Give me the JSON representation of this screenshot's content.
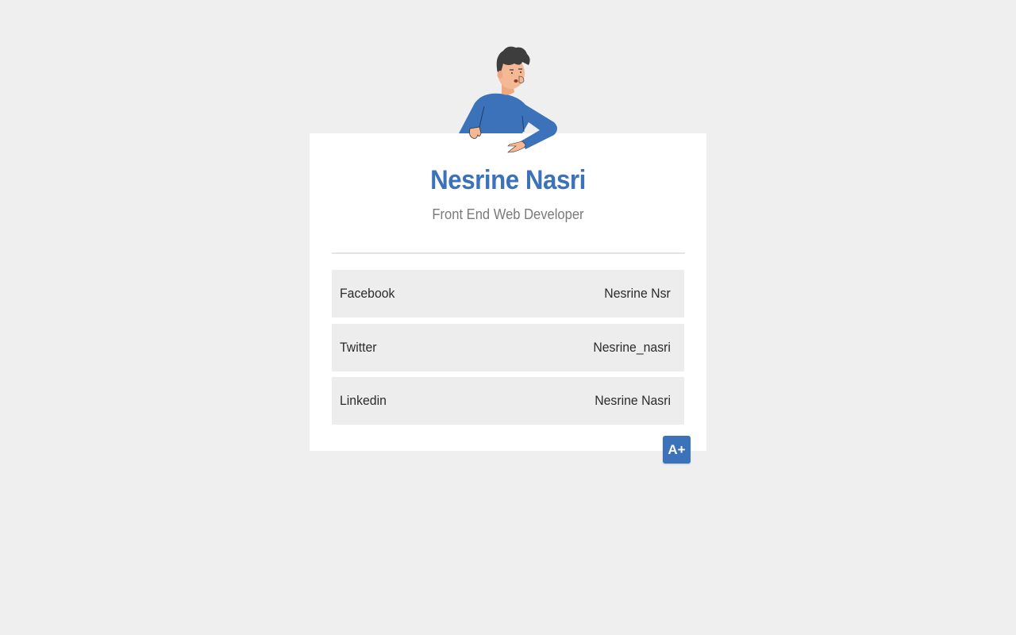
{
  "profile": {
    "name": "Nesrine Nasri",
    "title": "Front End Web Developer"
  },
  "links": [
    {
      "platform": "Facebook",
      "handle": "Nesrine Nsr"
    },
    {
      "platform": "Twitter",
      "handle": "Nesrine_nasri"
    },
    {
      "platform": "Linkedin",
      "handle": "Nesrine Nasri"
    }
  ],
  "font_button": {
    "label": "A+",
    "icon": "increase-font-size"
  },
  "colors": {
    "accent": "#3b72b9",
    "background": "#efefef",
    "card": "#ffffff",
    "row": "#ededed",
    "subtitle": "#7a7a7a"
  }
}
